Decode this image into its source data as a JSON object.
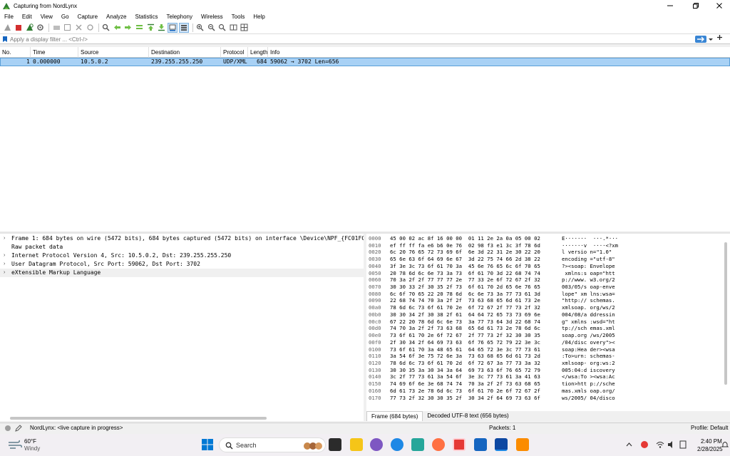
{
  "window": {
    "title": "Capturing from NordLynx",
    "controls": [
      "minimize-icon",
      "maximize-icon",
      "close-icon"
    ]
  },
  "menu": [
    "File",
    "Edit",
    "View",
    "Go",
    "Capture",
    "Analyze",
    "Statistics",
    "Telephony",
    "Wireless",
    "Tools",
    "Help"
  ],
  "filter": {
    "placeholder": "Apply a display filter ... <Ctrl-/>"
  },
  "packet_list": {
    "columns": [
      "No.",
      "Time",
      "Source",
      "Destination",
      "Protocol",
      "Length",
      "Info"
    ],
    "rows": [
      {
        "no": "1",
        "time": "0.000000",
        "source": "10.5.0.2",
        "destination": "239.255.255.250",
        "protocol": "UDP/XML",
        "length": "684",
        "info": "59062 → 3702 Len=656"
      }
    ]
  },
  "details": [
    "Frame 1: 684 bytes on wire (5472 bits), 684 bytes captured (5472 bits) on interface \\Device\\NPF_{FC01FCD",
    "Raw packet data",
    "Internet Protocol Version 4, Src: 10.5.0.2, Dst: 239.255.255.250",
    "User Datagram Protocol, Src Port: 59062, Dst Port: 3702",
    "eXtensible Markup Language"
  ],
  "bytes": [
    {
      "off": "0000",
      "hex": "45 00 02 ac 8f 16 00 00  01 11 2e 2a 0a 05 00 02",
      "ascii": "E·······  ···.*···"
    },
    {
      "off": "0010",
      "hex": "ef ff ff fa e6 b6 0e 76  02 98 f3 e1 3c 3f 78 6d",
      "ascii": "·······v  ····<?xm"
    },
    {
      "off": "0020",
      "hex": "6c 20 76 65 72 73 69 6f  6e 3d 22 31 2e 30 22 20",
      "ascii": "l versio n=\"1.0\" "
    },
    {
      "off": "0030",
      "hex": "65 6e 63 6f 64 69 6e 67  3d 22 75 74 66 2d 38 22",
      "ascii": "encoding =\"utf-8\""
    },
    {
      "off": "0040",
      "hex": "3f 3e 3c 73 6f 61 70 3a  45 6e 76 65 6c 6f 70 65",
      "ascii": "?><soap: Envelope"
    },
    {
      "off": "0050",
      "hex": "20 78 6d 6c 6e 73 3a 73  6f 61 70 3d 22 68 74 74",
      "ascii": " xmlns:s oap=\"htt"
    },
    {
      "off": "0060",
      "hex": "70 3a 2f 2f 77 77 77 2e  77 33 2e 6f 72 67 2f 32",
      "ascii": "p://www. w3.org/2"
    },
    {
      "off": "0070",
      "hex": "30 30 33 2f 30 35 2f 73  6f 61 70 2d 65 6e 76 65",
      "ascii": "003/05/s oap-enve"
    },
    {
      "off": "0080",
      "hex": "6c 6f 70 65 22 20 78 6d  6c 6e 73 3a 77 73 61 3d",
      "ascii": "lope\" xm lns:wsa="
    },
    {
      "off": "0090",
      "hex": "22 68 74 74 70 3a 2f 2f  73 63 68 65 6d 61 73 2e",
      "ascii": "\"http:// schemas."
    },
    {
      "off": "00a0",
      "hex": "78 6d 6c 73 6f 61 70 2e  6f 72 67 2f 77 73 2f 32",
      "ascii": "xmlsoap. org/ws/2"
    },
    {
      "off": "00b0",
      "hex": "30 30 34 2f 30 38 2f 61  64 64 72 65 73 73 69 6e",
      "ascii": "004/08/a ddressin"
    },
    {
      "off": "00c0",
      "hex": "67 22 20 78 6d 6c 6e 73  3a 77 73 64 3d 22 68 74",
      "ascii": "g\" xmlns :wsd=\"ht"
    },
    {
      "off": "00d0",
      "hex": "74 70 3a 2f 2f 73 63 68  65 6d 61 73 2e 78 6d 6c",
      "ascii": "tp://sch emas.xml"
    },
    {
      "off": "00e0",
      "hex": "73 6f 61 70 2e 6f 72 67  2f 77 73 2f 32 30 30 35",
      "ascii": "soap.org /ws/2005"
    },
    {
      "off": "00f0",
      "hex": "2f 30 34 2f 64 69 73 63  6f 76 65 72 79 22 3e 3c",
      "ascii": "/04/disc overy\"><"
    },
    {
      "off": "0100",
      "hex": "73 6f 61 70 3a 48 65 61  64 65 72 3e 3c 77 73 61",
      "ascii": "soap:Hea der><wsa"
    },
    {
      "off": "0110",
      "hex": "3a 54 6f 3e 75 72 6e 3a  73 63 68 65 6d 61 73 2d",
      "ascii": ":To>urn: schemas-"
    },
    {
      "off": "0120",
      "hex": "78 6d 6c 73 6f 61 70 2d  6f 72 67 3a 77 73 3a 32",
      "ascii": "xmlsoap- org:ws:2"
    },
    {
      "off": "0130",
      "hex": "30 30 35 3a 30 34 3a 64  69 73 63 6f 76 65 72 79",
      "ascii": "005:04:d iscovery"
    },
    {
      "off": "0140",
      "hex": "3c 2f 77 73 61 3a 54 6f  3e 3c 77 73 61 3a 41 63",
      "ascii": "</wsa:To ><wsa:Ac"
    },
    {
      "off": "0150",
      "hex": "74 69 6f 6e 3e 68 74 74  70 3a 2f 2f 73 63 68 65",
      "ascii": "tion>htt p://sche"
    },
    {
      "off": "0160",
      "hex": "6d 61 73 2e 78 6d 6c 73  6f 61 70 2e 6f 72 67 2f",
      "ascii": "mas.xmls oap.org/"
    },
    {
      "off": "0170",
      "hex": "77 73 2f 32 30 30 35 2f  30 34 2f 64 69 73 63 6f",
      "ascii": "ws/2005/ 04/disco"
    }
  ],
  "bytes_tabs": [
    "Frame (684 bytes)",
    "Decoded UTF-8 text (656 bytes)"
  ],
  "status": {
    "interface": "NordLynx: <live capture in progress>",
    "packets": "Packets: 1",
    "profile": "Profile: Default"
  },
  "taskbar": {
    "weather_temp": "60°F",
    "weather_desc": "Windy",
    "search_label": "Search",
    "time": "2:40 PM",
    "date": "2/28/2025"
  },
  "colors": {
    "selected_row": "#a8d1f5",
    "selected_border": "#5a9fd8",
    "shark_green": "#2f7d32",
    "stop_red": "#d32f2f"
  }
}
